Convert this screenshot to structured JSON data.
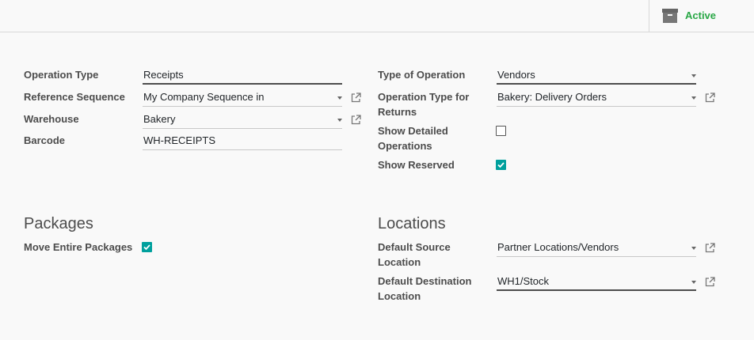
{
  "topbar": {
    "active_label": "Active",
    "active_color": "#28a745",
    "icon": "archive-icon"
  },
  "left": {
    "operation_type": {
      "label": "Operation Type",
      "value": "Receipts"
    },
    "reference_sequence": {
      "label": "Reference Sequence",
      "value": "My Company Sequence in"
    },
    "warehouse": {
      "label": "Warehouse",
      "value": "Bakery"
    },
    "barcode": {
      "label": "Barcode",
      "value": "WH-RECEIPTS"
    }
  },
  "right": {
    "type_of_operation": {
      "label": "Type of Operation",
      "value": "Vendors"
    },
    "operation_type_returns": {
      "label_line1": "Operation Type for",
      "label_line2": "Returns",
      "value": "Bakery: Delivery Orders"
    },
    "show_detailed_operations": {
      "label_line1": "Show Detailed",
      "label_line2": "Operations",
      "checked": false
    },
    "show_reserved": {
      "label": "Show Reserved",
      "checked": true
    }
  },
  "packages": {
    "title": "Packages",
    "move_entire_packages": {
      "label": "Move Entire Packages",
      "checked": true
    }
  },
  "locations": {
    "title": "Locations",
    "default_source": {
      "label_line1": "Default Source",
      "label_line2": "Location",
      "value": "Partner Locations/Vendors"
    },
    "default_destination": {
      "label_line1": "Default Destination",
      "label_line2": "Location",
      "value": "WH1/Stock"
    }
  },
  "checkbox_color": "#00a09d"
}
